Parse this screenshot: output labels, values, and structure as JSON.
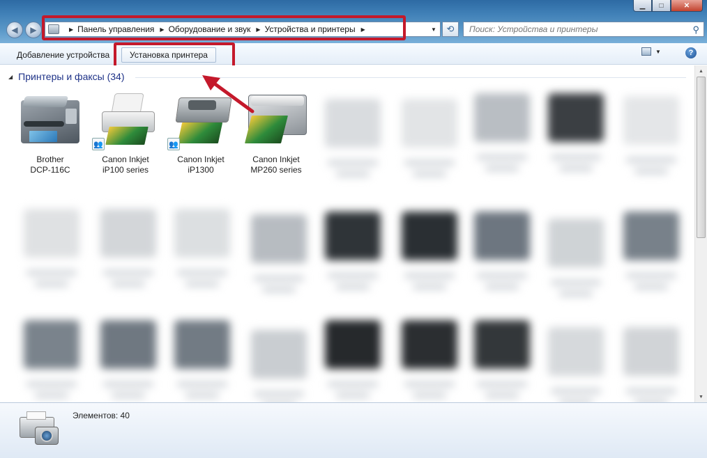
{
  "window": {
    "minimize": "▁",
    "maximize": "□",
    "close": "✕"
  },
  "address": {
    "breadcrumbs": [
      "Панель управления",
      "Оборудование и звук",
      "Устройства и принтеры"
    ],
    "search_placeholder": "Поиск: Устройства и принтеры"
  },
  "toolbar": {
    "add_device": "Добавление устройства",
    "install_printer": "Установка принтера",
    "help": "?"
  },
  "group": {
    "title": "Принтеры и факсы (34)"
  },
  "devices": [
    {
      "label": "Brother\nDCP-116C",
      "icon": "multifunction-printer-icon"
    },
    {
      "label": "Canon Inkjet\niP100 series",
      "icon": "inkjet-printer-icon",
      "shared": true
    },
    {
      "label": "Canon Inkjet\niP1300",
      "icon": "inkjet-printer-icon",
      "shared": true
    },
    {
      "label": "Canon Inkjet\nMP260 series",
      "icon": "inkjet-printer-icon"
    }
  ],
  "status": {
    "elements": "Элементов: 40"
  },
  "colors": {
    "highlight_box": "#c4192b",
    "group_header": "#1e3287"
  }
}
